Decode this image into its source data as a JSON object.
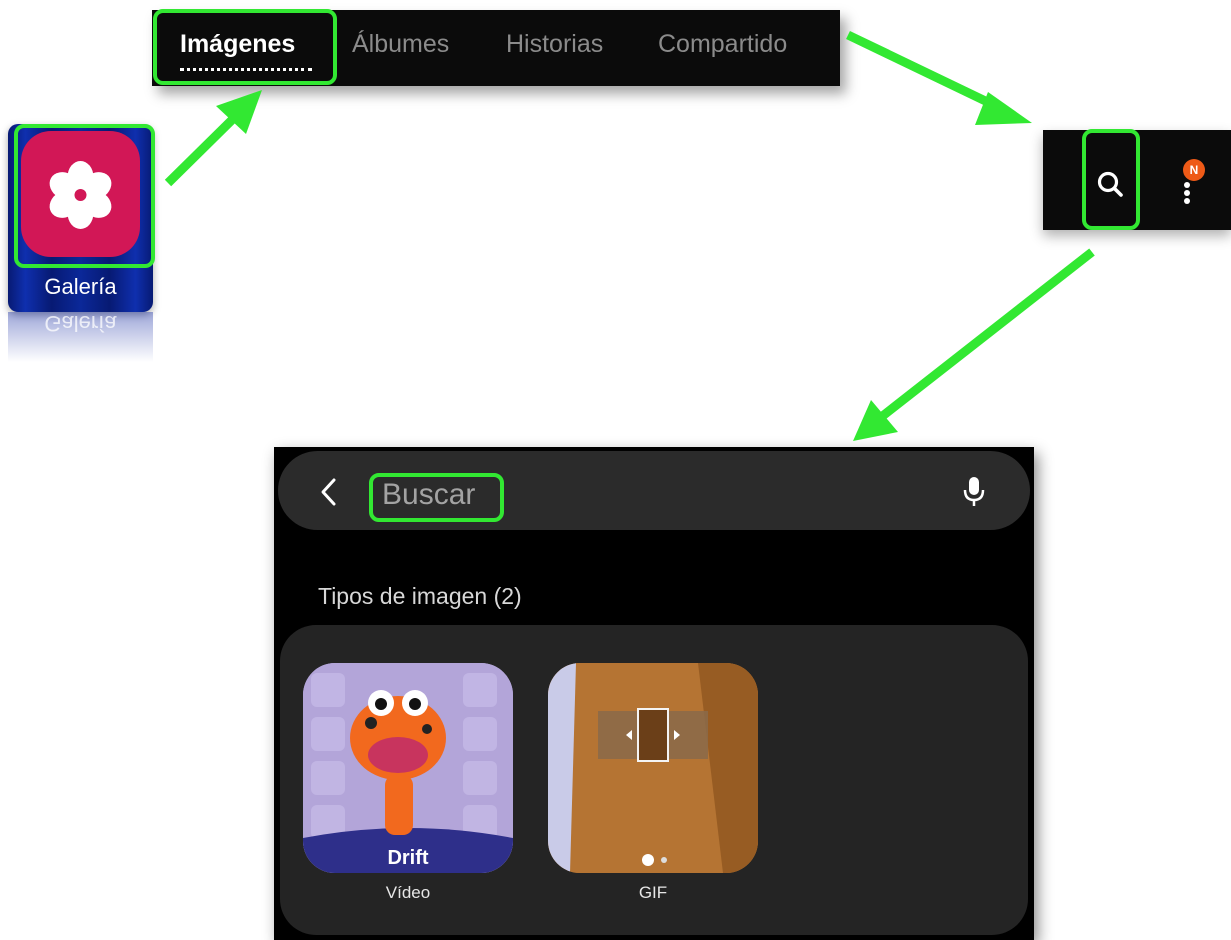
{
  "app_icon": {
    "label": "Galería",
    "reflection_label": "Galería"
  },
  "tabs": [
    {
      "label": "Imágenes",
      "active": true
    },
    {
      "label": "Álbumes",
      "active": false
    },
    {
      "label": "Historias",
      "active": false
    },
    {
      "label": "Compartido",
      "active": false
    }
  ],
  "toolbar": {
    "badge": "N"
  },
  "search": {
    "placeholder": "Buscar",
    "section_title": "Tipos de imagen (2)",
    "results": [
      {
        "label": "Vídeo",
        "thumb_caption": "Drift"
      },
      {
        "label": "GIF"
      }
    ]
  },
  "colors": {
    "highlight": "#32e832",
    "gallery_icon": "#d21756",
    "badge": "#ee5a17"
  },
  "icons": [
    "flower-icon",
    "search-icon",
    "more-options-icon",
    "back-icon",
    "microphone-icon"
  ]
}
